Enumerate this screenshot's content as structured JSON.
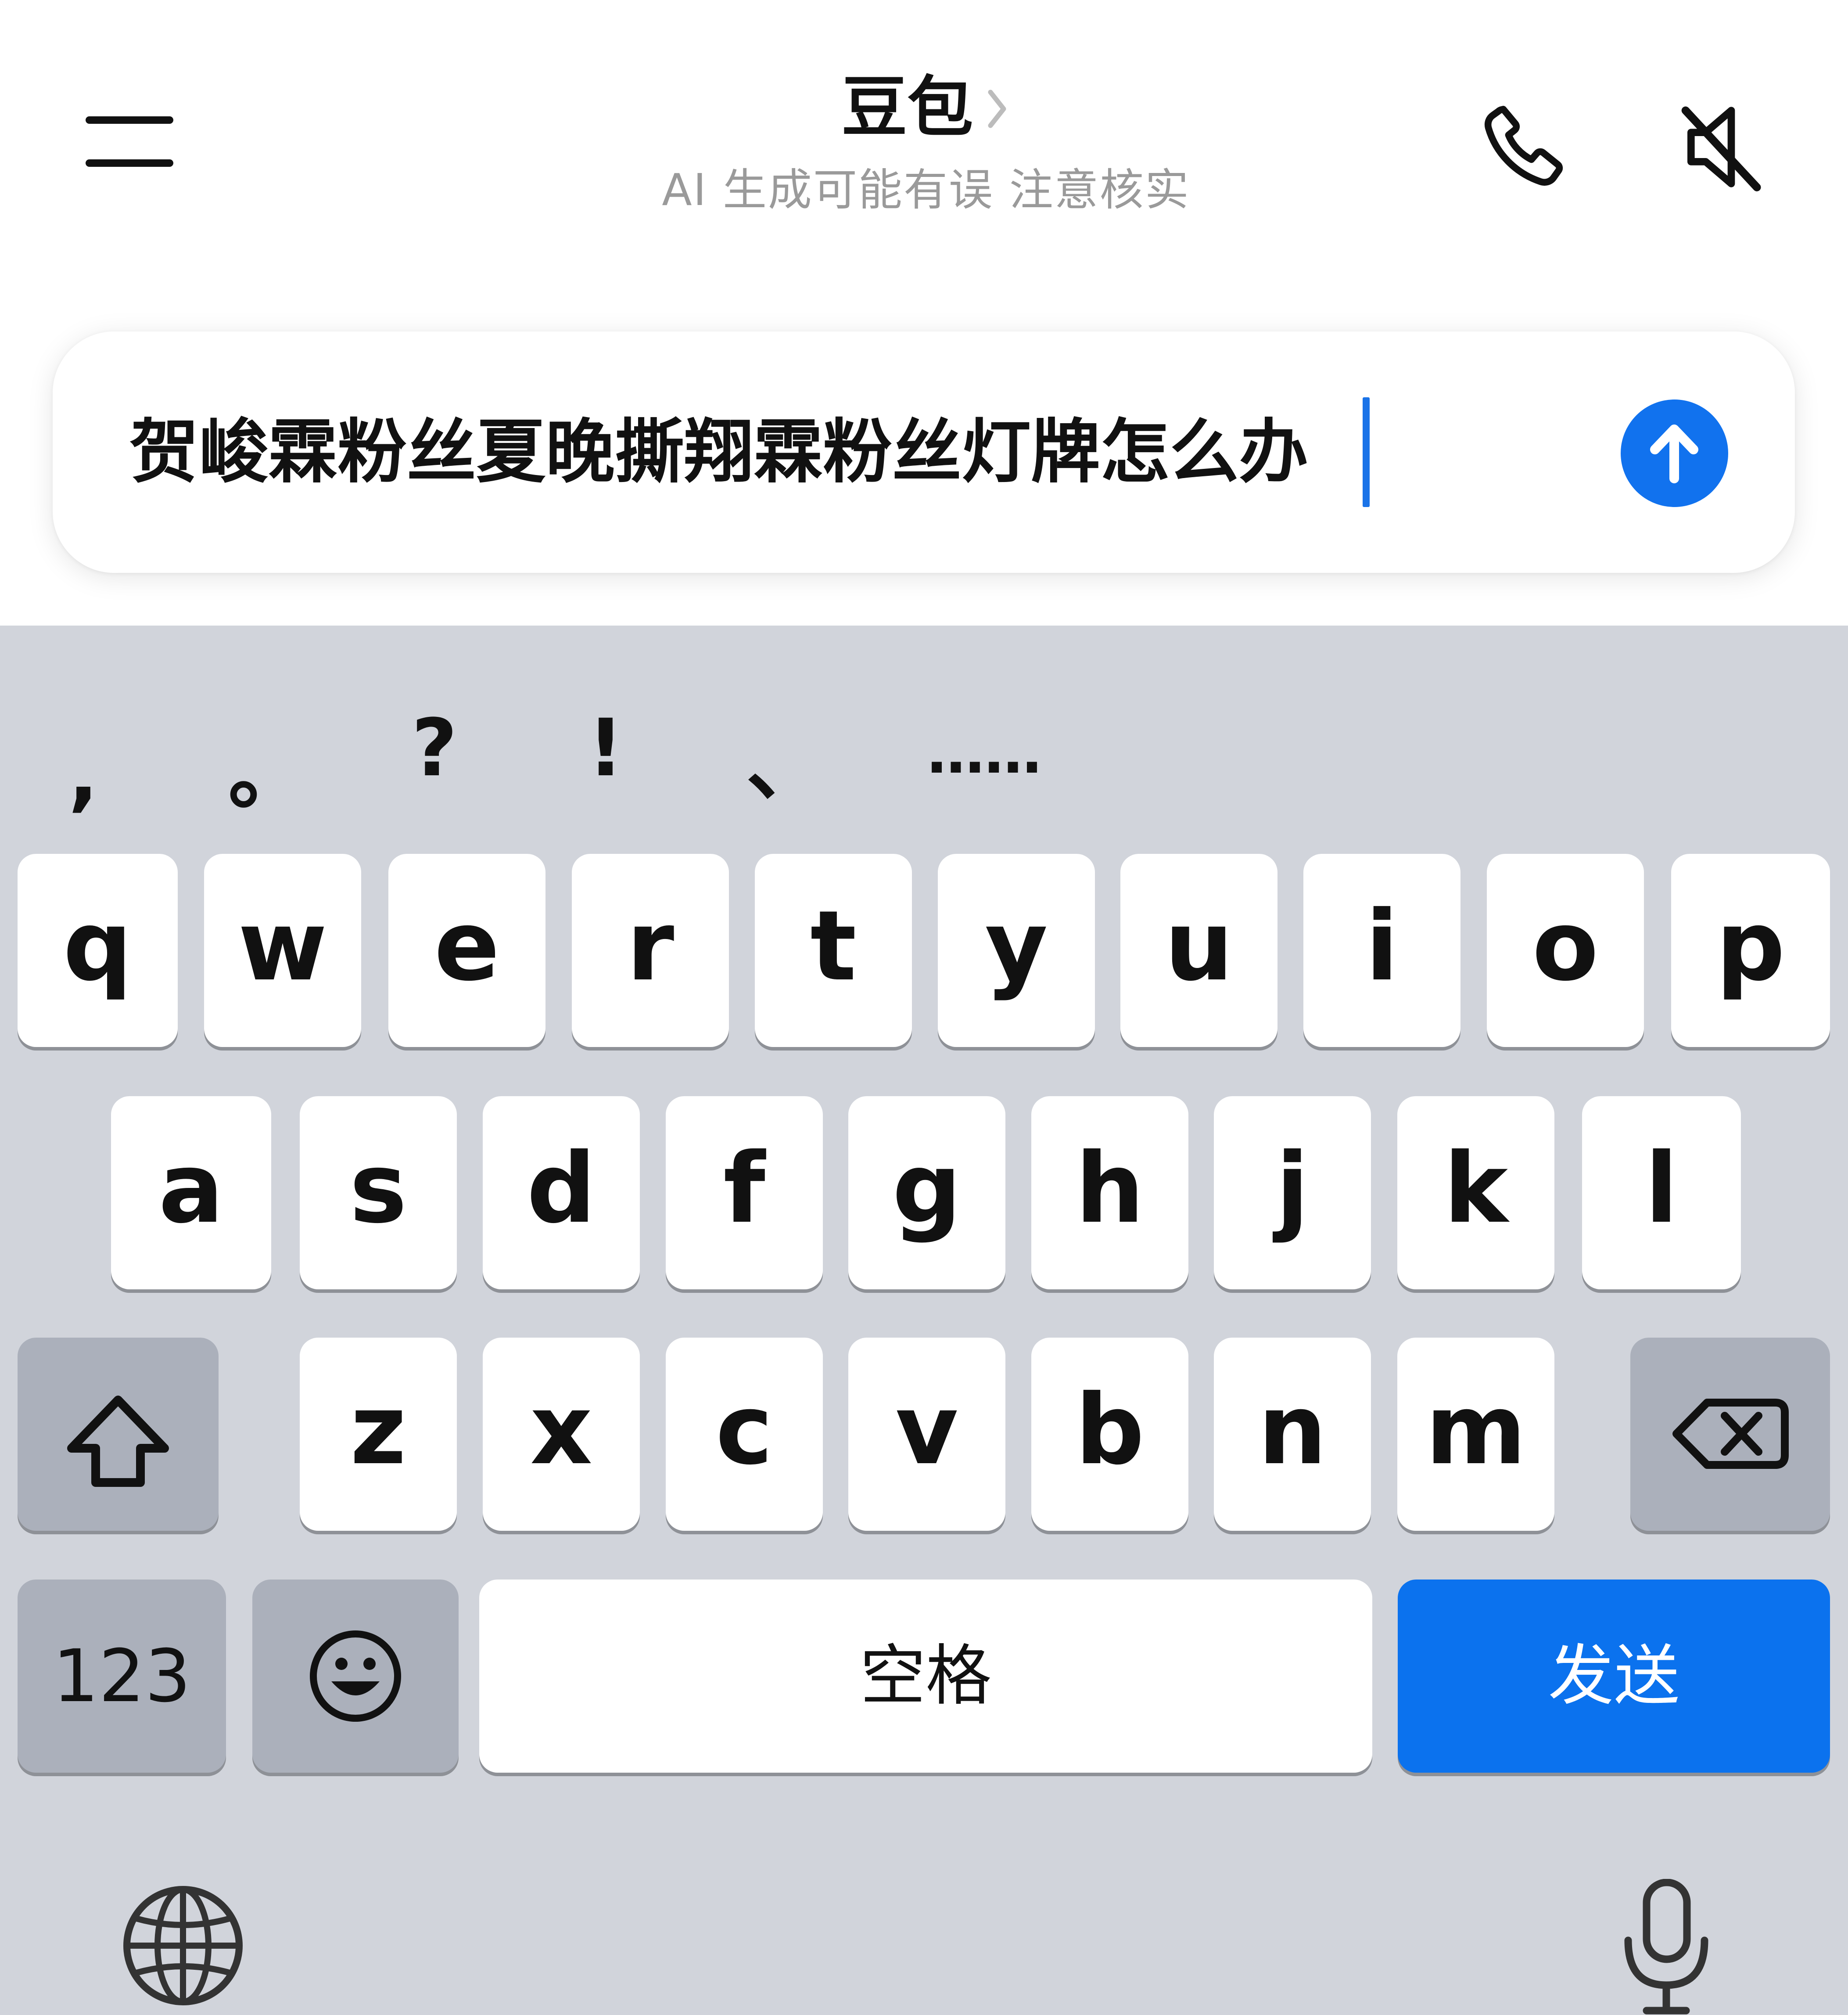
{
  "header": {
    "title": "豆包",
    "subtitle": "AI 生成可能有误 注意核实",
    "icons": {
      "menu": "menu-icon",
      "title_chevron": "chevron-right-icon",
      "phone": "phone-icon",
      "mute": "speaker-muted-icon"
    }
  },
  "input": {
    "value": "贺峻霖粉丝夏晚撕翔霖粉丝灯牌怎么办",
    "send_icon": "arrow-up-icon"
  },
  "keyboard": {
    "punctuation": [
      ",",
      "。",
      "?",
      "!",
      "、",
      "......"
    ],
    "row1": [
      "q",
      "w",
      "e",
      "r",
      "t",
      "y",
      "u",
      "i",
      "o",
      "p"
    ],
    "row2": [
      "a",
      "s",
      "d",
      "f",
      "g",
      "h",
      "j",
      "k",
      "l"
    ],
    "row3": [
      "z",
      "x",
      "c",
      "v",
      "b",
      "n",
      "m"
    ],
    "shift_icon": "shift-icon",
    "backspace_icon": "backspace-icon",
    "numbers_label": "123",
    "emoji_icon": "emoji-icon",
    "space_label": "空格",
    "send_label": "发送",
    "globe_icon": "globe-icon",
    "mic_icon": "microphone-icon"
  },
  "colors": {
    "accent": "#1172ee",
    "keyboard_bg": "#d1d4db",
    "key_bg": "#ffffff",
    "key_dark_bg": "#abb0bb",
    "subtitle": "#9a9a9a",
    "caret": "#1a73e8"
  }
}
